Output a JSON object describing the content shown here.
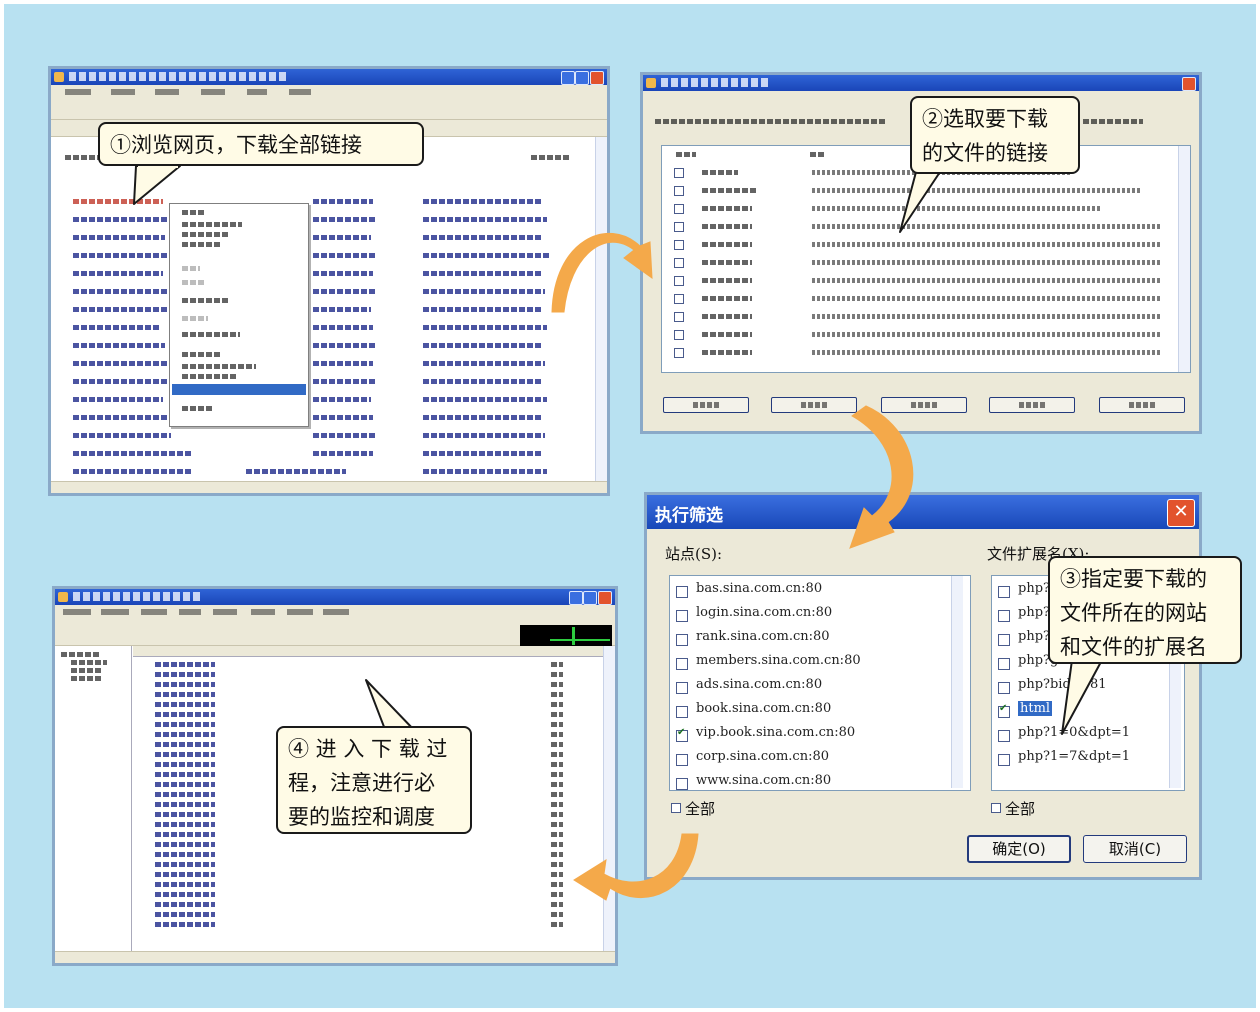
{
  "figure": {
    "background_color": "#b8e1f1",
    "callout_fill": "#fffbe6",
    "arrow_color": "#f4a94a"
  },
  "steps": [
    {
      "id": 1,
      "text": "①浏览网页，下载全部链接"
    },
    {
      "id": 2,
      "text": "②选取要下载\n的文件的链接"
    },
    {
      "id": 3,
      "text": "③指定要下载的\n文件所在的网站\n和文件的扩展名"
    },
    {
      "id": 4,
      "text": "④ 进 入 下 载 过\n程，注意进行必\n要的监控和调度"
    }
  ],
  "filter_dialog": {
    "title": "执行筛选",
    "sites_label": "站点(S):",
    "ext_label": "文件扩展名(X):",
    "sites": [
      {
        "label": "bas.sina.com.cn:80",
        "checked": false
      },
      {
        "label": "login.sina.com.cn:80",
        "checked": false
      },
      {
        "label": "rank.sina.com.cn:80",
        "checked": false
      },
      {
        "label": "members.sina.com.cn:80",
        "checked": false
      },
      {
        "label": "ads.sina.com.cn:80",
        "checked": false
      },
      {
        "label": "book.sina.com.cn:80",
        "checked": false
      },
      {
        "label": "vip.book.sina.com.cn:80",
        "checked": true
      },
      {
        "label": "corp.sina.com.cn:80",
        "checked": false
      },
      {
        "label": "www.sina.com.cn:80",
        "checked": false
      }
    ],
    "extensions": [
      {
        "label": "php?",
        "checked": false
      },
      {
        "label": "php?",
        "checked": false
      },
      {
        "label": "php?",
        "checked": false
      },
      {
        "label": "php?gr=181",
        "checked": false
      },
      {
        "label": "php?bid=181",
        "checked": false
      },
      {
        "label": "html",
        "checked": true
      },
      {
        "label": "php?1=0&dpt=1",
        "checked": false
      },
      {
        "label": "php?1=7&dpt=1",
        "checked": false
      }
    ],
    "select_all_sites": "全部",
    "select_all_ext": "全部",
    "ok_label": "确定(O)",
    "cancel_label": "取消(C)"
  }
}
